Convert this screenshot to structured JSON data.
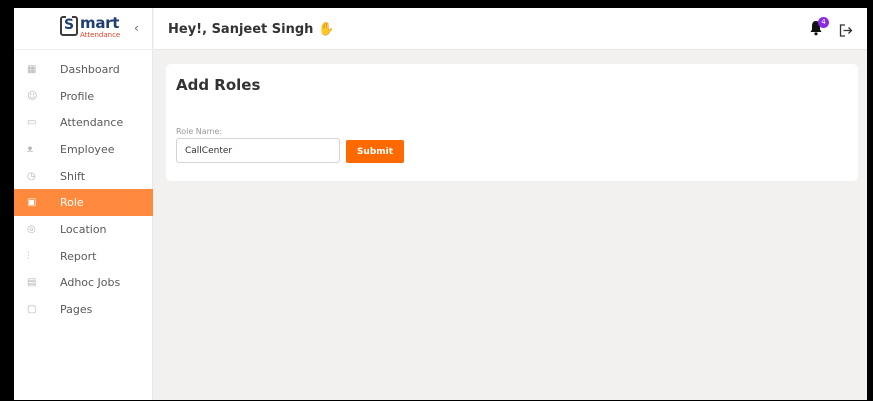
{
  "brand": {
    "logo_main": "mart",
    "logo_letter": "S",
    "logo_sub": "Attendance",
    "collapse_icon": "‹"
  },
  "header": {
    "greeting": "Hey!, Sanjeet Singh",
    "notification_count": "4"
  },
  "sidebar": {
    "items": [
      {
        "label": "Dashboard",
        "icon": "dashboard-icon",
        "glyph": "▦",
        "active": false
      },
      {
        "label": "Profile",
        "icon": "profile-icon",
        "glyph": "☺",
        "active": false
      },
      {
        "label": "Attendance",
        "icon": "attendance-icon",
        "glyph": "▭",
        "active": false
      },
      {
        "label": "Employee",
        "icon": "employee-icon",
        "glyph": "ᴥ",
        "active": false
      },
      {
        "label": "Shift",
        "icon": "shift-icon",
        "glyph": "◷",
        "active": false
      },
      {
        "label": "Role",
        "icon": "role-icon",
        "glyph": "▣",
        "active": true
      },
      {
        "label": "Location",
        "icon": "location-icon",
        "glyph": "◎",
        "active": false
      },
      {
        "label": "Report",
        "icon": "report-icon",
        "glyph": "⫶",
        "active": false
      },
      {
        "label": "Adhoc Jobs",
        "icon": "adhoc-jobs-icon",
        "glyph": "▤",
        "active": false
      },
      {
        "label": "Pages",
        "icon": "pages-icon",
        "glyph": "▢",
        "active": false
      }
    ]
  },
  "main": {
    "title": "Add Roles",
    "form": {
      "role_label": "Role Name:",
      "role_value": "CallCenter",
      "submit_label": "Submit"
    }
  },
  "colors": {
    "accent": "#ff8a3d",
    "submit": "#ff6a00",
    "badge": "#8a2be2",
    "brand": "#1f3f74"
  }
}
